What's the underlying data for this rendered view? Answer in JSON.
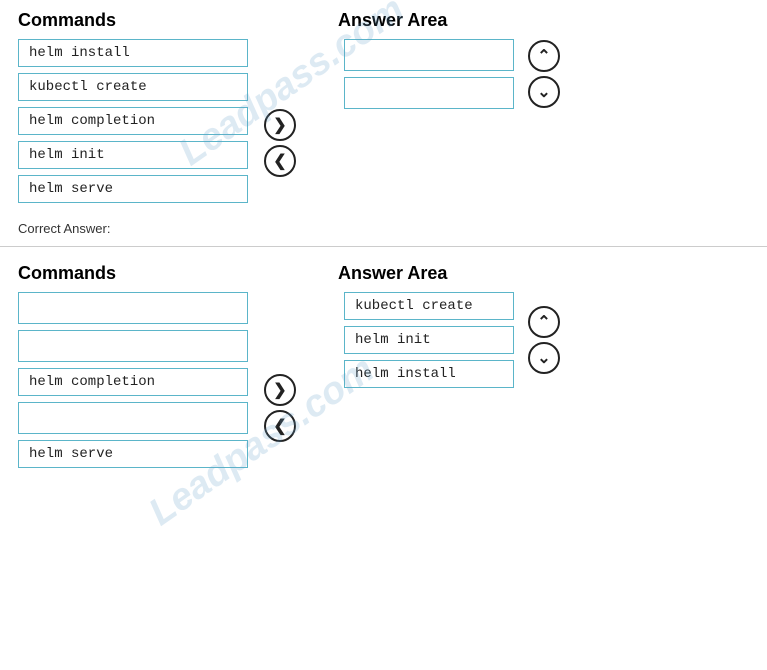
{
  "section1": {
    "commands_label": "Commands",
    "answer_area_label": "Answer Area",
    "commands": [
      "helm install",
      "kubectl create",
      "helm completion",
      "helm init",
      "helm serve"
    ],
    "answer_items": []
  },
  "correct_answer_label": "Correct Answer:",
  "section2": {
    "commands_label": "Commands",
    "answer_area_label": "Answer Area",
    "commands": [
      "",
      "",
      "helm completion",
      "",
      "helm serve"
    ],
    "answer_items": [
      "kubectl create",
      "helm init",
      "helm install"
    ]
  },
  "arrows": {
    "right": "❯",
    "left": "❮",
    "up": "⌃",
    "down": "⌄"
  }
}
